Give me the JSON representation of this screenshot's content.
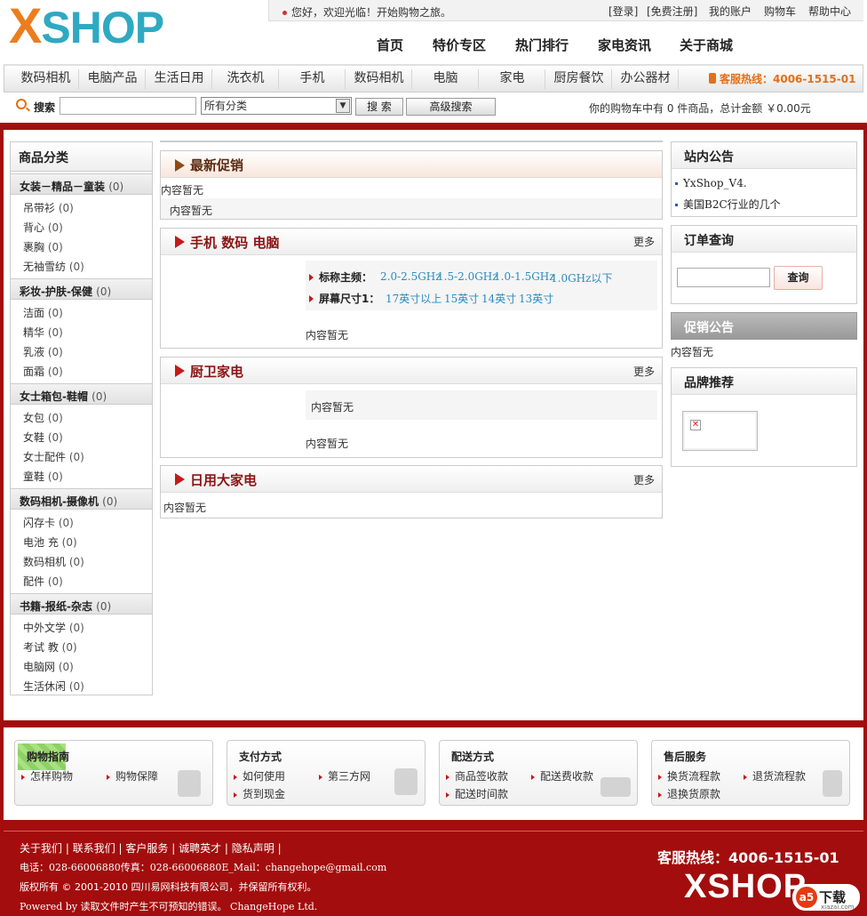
{
  "logo": {
    "first": "X",
    "rest": "SHOP"
  },
  "topbar": {
    "welcome": "您好，欢迎光临！开始购物之旅。",
    "links": [
      "[登录]",
      "[免费注册]",
      "我的账户",
      "购物车",
      "帮助中心"
    ]
  },
  "main_nav": [
    "首页",
    "特价专区",
    "热门排行",
    "家电资讯",
    "关于商城"
  ],
  "categories": [
    "数码相机",
    "电脑产品",
    "生活日用",
    "洗衣机",
    "手机",
    "数码相机",
    "电脑",
    "家电",
    "厨房餐饮",
    "办公器材"
  ],
  "hotline": "客服热线：4006-1515-01",
  "search": {
    "label": "搜索",
    "value": "",
    "select_value": "所有分类",
    "button": "搜 索",
    "advanced": "高级搜索",
    "cart_info": "你的购物车中有 0 件商品，总计金额 ￥0.00元"
  },
  "left": {
    "title": "商品分类",
    "groups": [
      {
        "name": "女装－精品－童装",
        "count": "(0)",
        "items": [
          {
            "label": "吊带衫",
            "count": "(0)"
          },
          {
            "label": "背心",
            "count": "(0)"
          },
          {
            "label": "裹胸",
            "count": "(0)"
          },
          {
            "label": "无袖雪纺",
            "count": "(0)"
          }
        ]
      },
      {
        "name": "彩妆-护肤-保健",
        "count": "(0)",
        "items": [
          {
            "label": "洁面",
            "count": "(0)"
          },
          {
            "label": "精华",
            "count": "(0)"
          },
          {
            "label": "乳液",
            "count": "(0)"
          },
          {
            "label": "面霜",
            "count": "(0)"
          }
        ]
      },
      {
        "name": "女士箱包-鞋帽",
        "count": "(0)",
        "items": [
          {
            "label": "女包",
            "count": "(0)"
          },
          {
            "label": "女鞋",
            "count": "(0)"
          },
          {
            "label": "女士配件",
            "count": "(0)"
          },
          {
            "label": "童鞋",
            "count": "(0)"
          }
        ]
      },
      {
        "name": "数码相机-摄像机",
        "count": "(0)",
        "items": [
          {
            "label": "闪存卡",
            "count": "(0)"
          },
          {
            "label": "电池 充",
            "count": "(0)"
          },
          {
            "label": "数码相机",
            "count": "(0)"
          },
          {
            "label": "配件",
            "count": "(0)"
          }
        ]
      },
      {
        "name": "书籍-报纸-杂志",
        "count": "(0)",
        "items": [
          {
            "label": "中外文学",
            "count": "(0)"
          },
          {
            "label": "考试 教",
            "count": "(0)"
          },
          {
            "label": "电脑网",
            "count": "(0)"
          },
          {
            "label": "生活休闲",
            "count": "(0)"
          }
        ]
      }
    ]
  },
  "center": {
    "promo": {
      "title": "最新促销",
      "line1": "内容暂无",
      "line2": "内容暂无"
    },
    "phone": {
      "title": "手机 数码 电脑",
      "more": "更多",
      "filter1": {
        "label": "标称主频：",
        "values": [
          "2.0-2.5GHz",
          "1.5-2.0GHz",
          "1.0-1.5GHz",
          "1.0GHz以下"
        ]
      },
      "filter2": {
        "label": "屏幕尺寸1：",
        "values": [
          "17英寸以上",
          "15英寸",
          "14英寸",
          "13英寸"
        ]
      },
      "empty": "内容暂无"
    },
    "kitchen": {
      "title": "厨卫家电",
      "more": "更多",
      "box": "内容暂无",
      "empty": "内容暂无"
    },
    "appliance": {
      "title": "日用大家电",
      "more": "更多",
      "empty": "内容暂无"
    }
  },
  "right": {
    "notice": {
      "title": "站内公告",
      "items": [
        "YxShop_V4.",
        "美国B2C行业的几个"
      ]
    },
    "order": {
      "title": "订单查询",
      "value": "",
      "button": "查询"
    },
    "promo_notice": {
      "title": "促销公告",
      "text": "内容暂无"
    },
    "brand": {
      "title": "品牌推荐"
    }
  },
  "guide": [
    {
      "title": "购物指南",
      "links": [
        "怎样购物",
        "购物保障"
      ]
    },
    {
      "title": "支付方式",
      "links": [
        "如何使用",
        "第三方网",
        "货到现金"
      ]
    },
    {
      "title": "配送方式",
      "links": [
        "商品签收款",
        "配送费收款",
        "配送时间款"
      ]
    },
    {
      "title": "售后服务",
      "links": [
        "换货流程款",
        "退货流程款",
        "退换货原款"
      ]
    }
  ],
  "footer": {
    "links": [
      "关于我们",
      "联系我们",
      "客户服务",
      "诚聘英才",
      "隐私声明"
    ],
    "contact": "电话：028-66006880传真：028-66006880E_Mail：changehope@gmail.com",
    "copyright": "版权所有 © 2001-2010 四川易网科技有限公司，并保留所有权利。",
    "powered": "Powered by 读取文件时产生不可预知的错误。 ChangeHope Ltd.",
    "hotline": "客服热线：4006-1515-01",
    "logo": "XSHOP",
    "watermark": "下载",
    "watermark_badge": "a5",
    "watermark_url": "xiazai.com"
  },
  "colors": {
    "brand_red": "#a30d0d",
    "accent_orange": "#e46f15",
    "logo_blue": "#2fa9c2",
    "link_blue": "#2a8bc0"
  }
}
